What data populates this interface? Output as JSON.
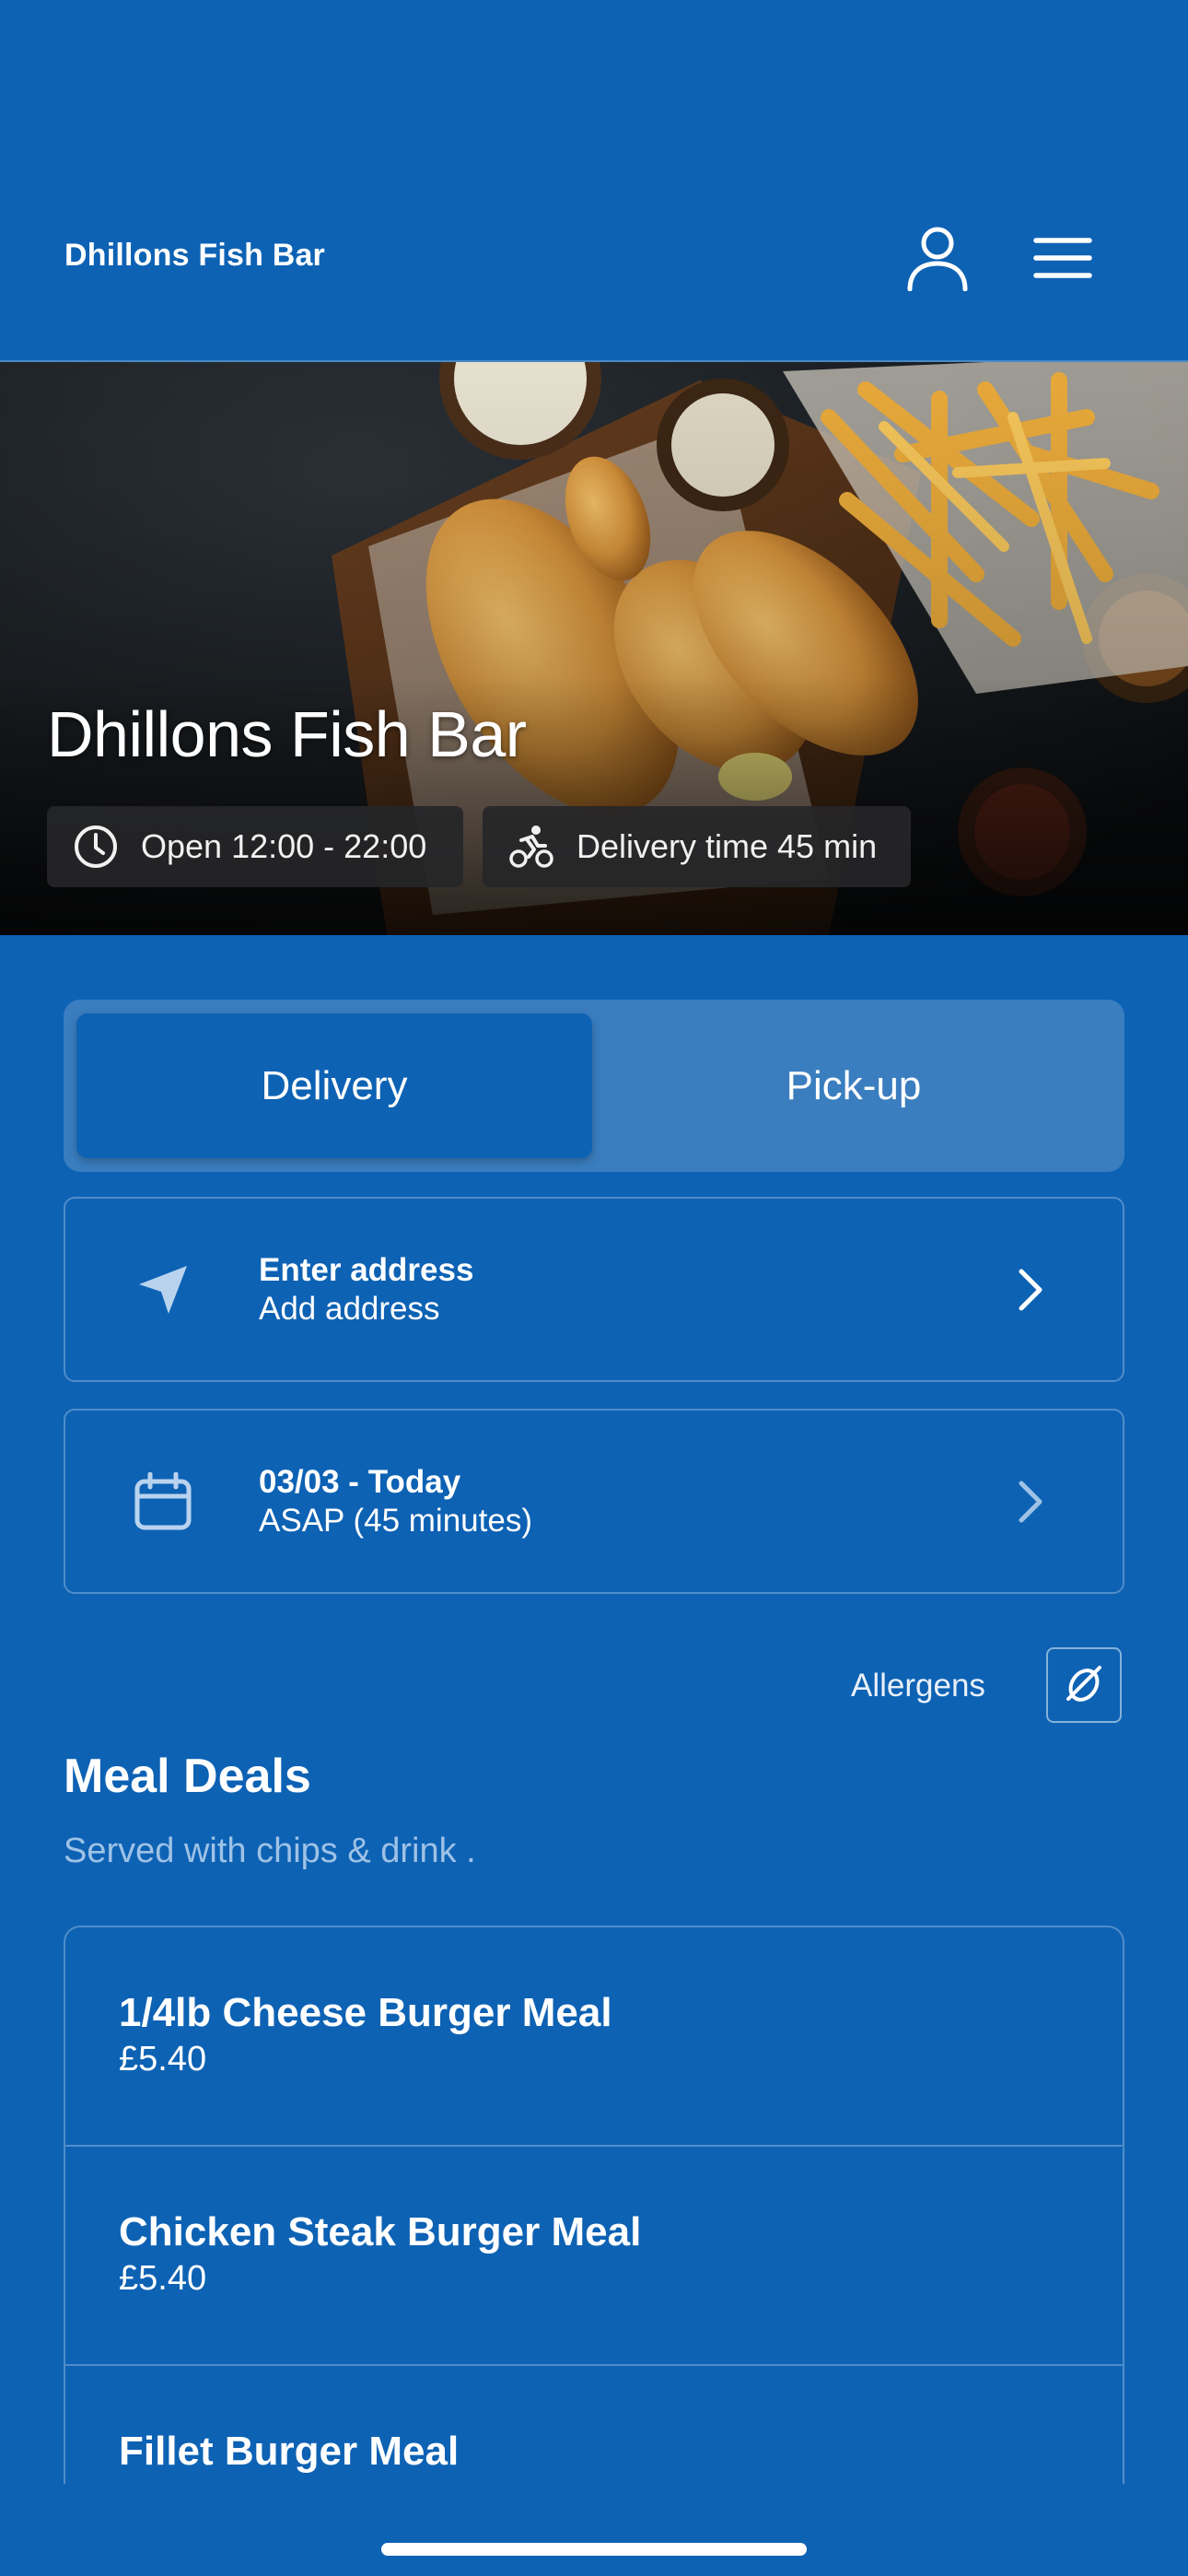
{
  "header": {
    "brand": "Dhillons Fish Bar",
    "account_icon": "user-icon",
    "menu_icon": "hamburger-menu-icon"
  },
  "hero": {
    "title": "Dhillons Fish Bar",
    "hours": "Open 12:00 - 22:00",
    "hours_icon": "clock-icon",
    "delivery_time": "Delivery time 45 min",
    "delivery_icon": "bicycle-icon"
  },
  "order_mode": {
    "delivery_label": "Delivery",
    "pickup_label": "Pick-up",
    "selected": "Delivery"
  },
  "address_card": {
    "title": "Enter address",
    "subtitle": "Add address",
    "icon": "location-arrow-icon"
  },
  "date_card": {
    "title": "03/03 - Today",
    "subtitle": "ASAP (45 minutes)",
    "icon": "calendar-icon"
  },
  "allergens": {
    "label": "Allergens",
    "icon": "allergen-icon"
  },
  "section": {
    "title": "Meal Deals",
    "subtitle": "Served with chips & drink ."
  },
  "menu_items": [
    {
      "name": "1/4lb Cheese Burger Meal",
      "price": "£5.40"
    },
    {
      "name": "Chicken Steak Burger Meal",
      "price": "£5.40"
    },
    {
      "name": "Fillet Burger Meal",
      "price": ""
    }
  ],
  "colors": {
    "brand_blue": "#0d62b4",
    "toggle_track": "#3a7ec0",
    "subtitle_blue": "#9ec2e6"
  }
}
